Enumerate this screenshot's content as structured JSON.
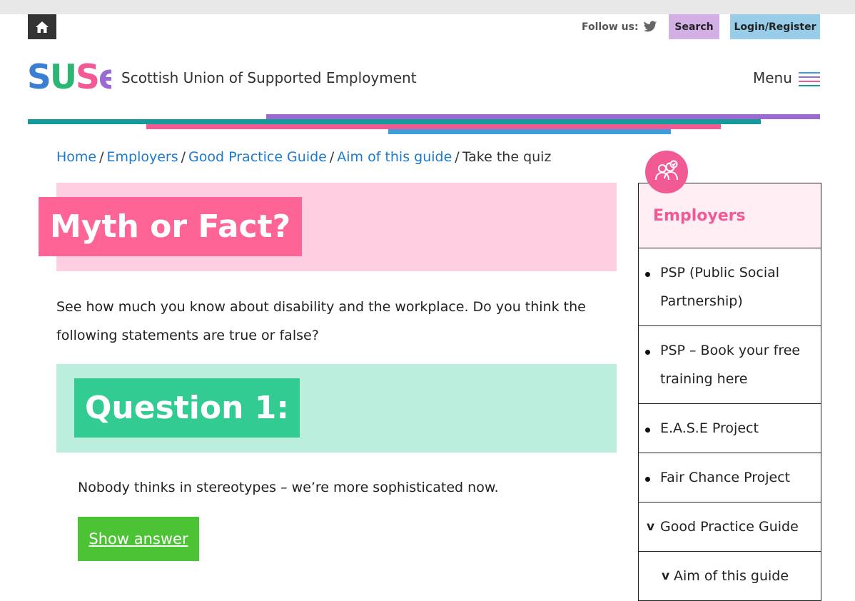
{
  "header": {
    "follow_label": "Follow us:",
    "search_label": "Search",
    "login_label": "Login/Register",
    "logo_text": "SUSe",
    "org_name": "Scottish Union of Supported Employment",
    "menu_label": "Menu"
  },
  "breadcrumb": {
    "items": [
      "Home",
      "Employers",
      "Good Practice Guide",
      "Aim of this guide"
    ],
    "current": "Take the quiz",
    "separator": "/"
  },
  "main": {
    "title": "Myth or Fact?",
    "intro": "See how much you know about disability and the workplace. Do you think the following statements are true or false?",
    "question_title": "Question 1:",
    "question_text": "Nobody thinks in stereotypes – we’re more sophisticated now.",
    "show_answer_label": "Show answer"
  },
  "sidebar": {
    "heading": "Employers",
    "items": [
      "PSP (Public Social Partnership)",
      "PSP – Book your free training here",
      "E.A.S.E Project",
      "Fair Chance Project",
      "Good Practice Guide",
      "Aim of this guide"
    ],
    "expand_marker": "v"
  },
  "icons": {
    "home": "home-icon",
    "twitter": "twitter-icon",
    "menu": "hamburger-menu-icon",
    "employers": "people-check-icon"
  },
  "colors": {
    "pink": "#fe6496",
    "pink_light": "#ffcfe1",
    "green": "#32cc92",
    "green_light": "#bbeedd",
    "button_green": "#4cc334",
    "link_blue": "#1a7ad0",
    "purple": "#9b6bd1",
    "teal": "#159a9a",
    "blue": "#3c9fdc"
  }
}
